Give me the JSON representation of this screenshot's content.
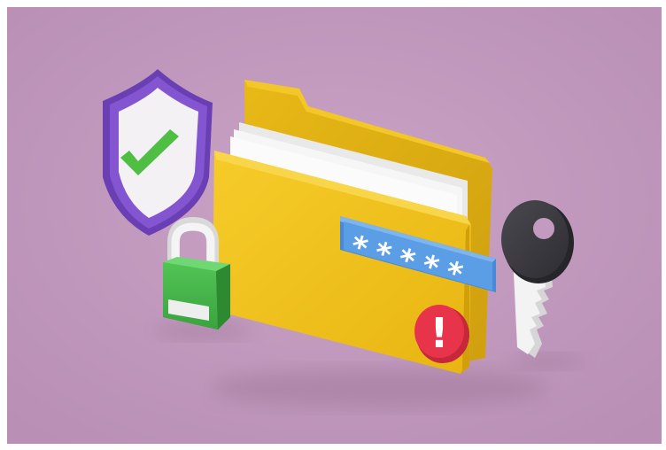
{
  "scene": {
    "background_color": "#c49bc0",
    "objects": [
      {
        "name": "shield-icon",
        "colors": {
          "rim": "#7a4fc4",
          "face": "#f1f0f2",
          "check": "#4fbe43"
        }
      },
      {
        "name": "padlock-icon",
        "colors": {
          "body": "#45b548",
          "shackle": "#f2f2f2",
          "label": "#e6e6e6"
        }
      },
      {
        "name": "folder-icon",
        "colors": {
          "front": "#f1c21b",
          "back": "#d8a912",
          "paper": "#f7f7f7"
        }
      },
      {
        "name": "password-field",
        "text": "*****",
        "colors": {
          "field": "#5c9ee6",
          "dots": "#ffffff"
        }
      },
      {
        "name": "alert-icon",
        "text": "!",
        "colors": {
          "circle": "#e8344a",
          "mark": "#ffffff"
        }
      },
      {
        "name": "key-icon",
        "colors": {
          "head": "#3a393e",
          "blade": "#f3f3f3"
        }
      }
    ]
  }
}
